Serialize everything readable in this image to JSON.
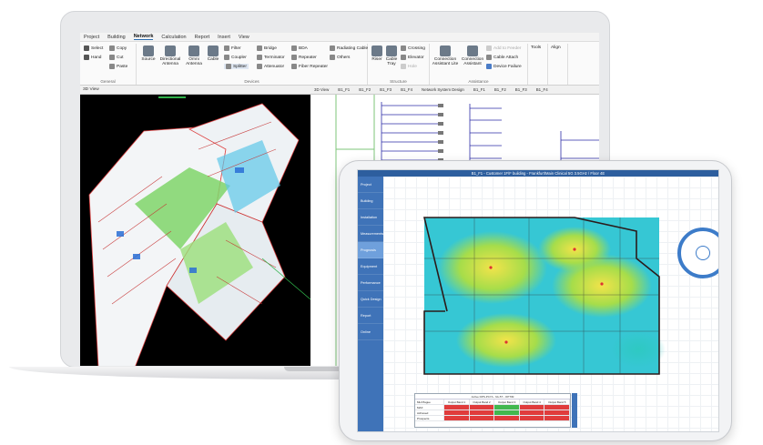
{
  "laptop": {
    "tabs": [
      "Project",
      "Building",
      "Network",
      "Calculation",
      "Report",
      "Insert",
      "View"
    ],
    "active_tab": "Network",
    "ribbon": {
      "general": {
        "label": "General",
        "select": "Select",
        "hand": "Hand",
        "copy": "Copy",
        "cut": "Cut",
        "paste": "Paste"
      },
      "devices": {
        "label": "Devices",
        "source": "Source",
        "directional_antenna": "Directional Antenna",
        "omni_antenna": "Omni Antenna",
        "cable": "Cable",
        "filter": "Filter",
        "coupler": "Coupler",
        "splitter": "Splitter",
        "bridge": "Bridge",
        "terminator": "Terminator",
        "attenuator": "Attenuator",
        "bda": "BDA",
        "repeater": "Repeater",
        "fiber_repeater": "Fiber Repeater",
        "radiating_cable": "Radiating Cable",
        "others": "Others"
      },
      "structure": {
        "label": "Structure",
        "riser": "Riser",
        "cable_tray": "Cable Tray",
        "crossing": "Crossing",
        "elevator": "Elevator",
        "hole": "Hole"
      },
      "assistance": {
        "label": "Assistance",
        "ca_lite": "Connection Assistant Lite",
        "ca": "Connection Assistant",
        "add_to_feeder": "Add to Feeder",
        "cable_attach": "Cable Attach",
        "device_failure": "Device Failure"
      },
      "tools": "Tools",
      "align": "Align"
    },
    "view3d_title": "3D View",
    "schematic_tabs": [
      "3D View",
      "B1_F1",
      "B1_F2",
      "B1_F3",
      "B1_F4",
      "Network System Design",
      "B1_F1",
      "B1_F2",
      "B1_F3",
      "B1_F4"
    ]
  },
  "tablet": {
    "title": "B1_F1 - Customer 1F/F building - Frankfurt/Main Clinical 5G 3.5GHz / Floor 4E",
    "sidebar": [
      "Project",
      "Building",
      "Installation",
      "Measurements",
      "Prognosis",
      "Equipment",
      "Performance",
      "Quick Design",
      "Report",
      "Online"
    ],
    "active_sidebar": "Prognosis",
    "table": {
      "header": "Active   DPS-PC7A - 6A-5T - OPTIM",
      "columns": [
        "MH Plague",
        "Output Band 1",
        "Output Band 2",
        "Output Band 3",
        "Output Band 4",
        "Output Band 5"
      ],
      "rows": [
        {
          "label": "MAX",
          "cells": [
            "",
            "",
            "",
            "",
            ""
          ],
          "status": [
            "red",
            "red",
            "green",
            "red",
            "red"
          ]
        },
        {
          "label": "Achieved",
          "cells": [
            "",
            "",
            "",
            "",
            ""
          ],
          "status": [
            "red",
            "red",
            "green",
            "red",
            "red"
          ]
        },
        {
          "label": "Prospects",
          "cells": [
            "",
            "",
            "",
            "",
            ""
          ],
          "status": [
            "red",
            "red",
            "red",
            "red",
            "red"
          ]
        }
      ]
    }
  },
  "colors": {
    "ribbon_blue": "#2b6cb0",
    "tablet_sidebar": "#3f73b8",
    "compass": "#3d7cc9"
  }
}
